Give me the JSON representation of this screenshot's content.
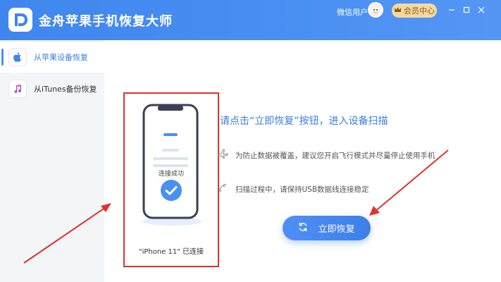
{
  "app": {
    "title": "金舟苹果手机恢复大师"
  },
  "header": {
    "user_name": "微信用户",
    "vip_label": "会员中心",
    "controls": [
      "minimize-icon",
      "restore-icon",
      "close-icon"
    ]
  },
  "sidebar": {
    "items": [
      {
        "label": "从苹果设备恢复",
        "icon": "apple-icon",
        "active": true
      },
      {
        "label": "从iTunes备份恢复",
        "icon": "music-note-icon",
        "active": false
      }
    ]
  },
  "main": {
    "phone_status": "连接成功",
    "device_connected": "\"iPhone 11\" 已连接",
    "headline": "请点击“立即恢复”按钮，进入设备扫描",
    "tips": [
      {
        "icon": "airplane-icon",
        "text": "为防止数据被覆盖，建议您开启飞行模式并尽量停止使用手机"
      },
      {
        "icon": "cable-icon",
        "text": "扫描过程中，请保持USB数据线连接稳定"
      }
    ],
    "recover_button": "立即恢复"
  },
  "colors": {
    "brand": "#4a8ff2",
    "accent_text": "#3b7ee6",
    "annotation": "#e23030",
    "vip_bg": "#f7d9a0"
  }
}
